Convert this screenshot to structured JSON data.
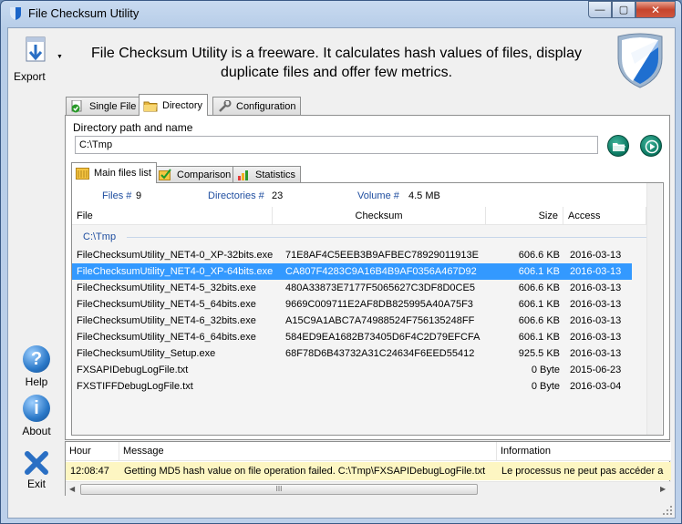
{
  "window": {
    "title": "File Checksum Utility",
    "controls": {
      "minimize": "—",
      "maximize": "▢",
      "close": "✕"
    }
  },
  "sidebar": {
    "export_label": "Export",
    "help_label": "Help",
    "about_label": "About",
    "exit_label": "Exit"
  },
  "header": {
    "line1": "File Checksum Utility is a freeware. It calculates hash values of files, display",
    "line2": "duplicate files and offer few metrics."
  },
  "main_tabs": [
    {
      "label": "Single File",
      "icon": "check-icon"
    },
    {
      "label": "Directory",
      "icon": "folder-icon",
      "active": true
    },
    {
      "label": "Configuration",
      "icon": "wrench-icon"
    }
  ],
  "directory": {
    "label": "Directory path and name",
    "path_value": "C:\\Tmp"
  },
  "sub_tabs": [
    {
      "label": "Main files list",
      "active": true
    },
    {
      "label": "Comparison"
    },
    {
      "label": "Statistics"
    }
  ],
  "metrics": {
    "files_label": "Files #",
    "files_value": "9",
    "dirs_label": "Directories #",
    "dirs_value": "23",
    "volume_label": "Volume #",
    "volume_value": "4.5 MB"
  },
  "file_list": {
    "columns": [
      "File",
      "Checksum",
      "Size",
      "Access"
    ],
    "group": "C:\\Tmp",
    "rows": [
      {
        "file": "FileChecksumUtility_NET4-0_XP-32bits.exe",
        "md5": "71E8AF4C5EEB3B9AFBEC78929011913E",
        "size": "606.6 KB",
        "access": "2016-03-13"
      },
      {
        "file": "FileChecksumUtility_NET4-0_XP-64bits.exe",
        "md5": "CA807F4283C9A16B4B9AF0356A467D92",
        "size": "606.1 KB",
        "access": "2016-03-13",
        "selected": true
      },
      {
        "file": "FileChecksumUtility_NET4-5_32bits.exe",
        "md5": "480A33873E7177F5065627C3DF8D0CE5",
        "size": "606.6 KB",
        "access": "2016-03-13"
      },
      {
        "file": "FileChecksumUtility_NET4-5_64bits.exe",
        "md5": "9669C009711E2AF8DB825995A40A75F3",
        "size": "606.1 KB",
        "access": "2016-03-13"
      },
      {
        "file": "FileChecksumUtility_NET4-6_32bits.exe",
        "md5": "A15C9A1ABC7A74988524F756135248FF",
        "size": "606.6 KB",
        "access": "2016-03-13"
      },
      {
        "file": "FileChecksumUtility_NET4-6_64bits.exe",
        "md5": "584ED9EA1682B73405D6F4C2D79EFCFA",
        "size": "606.1 KB",
        "access": "2016-03-13"
      },
      {
        "file": "FileChecksumUtility_Setup.exe",
        "md5": "68F78D6B43732A31C24634F6EED55412",
        "size": "925.5 KB",
        "access": "2016-03-13"
      },
      {
        "file": "FXSAPIDebugLogFile.txt",
        "md5": "",
        "size": "0 Byte",
        "access": "2015-06-23"
      },
      {
        "file": "FXSTIFFDebugLogFile.txt",
        "md5": "",
        "size": "0 Byte",
        "access": "2016-03-04"
      }
    ]
  },
  "log": {
    "columns": [
      "Hour",
      "Message",
      "Information"
    ],
    "rows": [
      {
        "hour": "12:08:47",
        "message": "Getting MD5 hash value on file operation failed. C:\\Tmp\\FXSAPIDebugLogFile.txt",
        "info": "Le processus ne peut pas accéder a"
      }
    ],
    "scroll_thumb": "III",
    "scroll_left": "◀",
    "scroll_right": "▶"
  },
  "colors": {
    "accent_blue": "#1f4ea0",
    "selection": "#3399ff",
    "log_highlight": "#fdf6c2",
    "action_green": "#0c7a63"
  }
}
